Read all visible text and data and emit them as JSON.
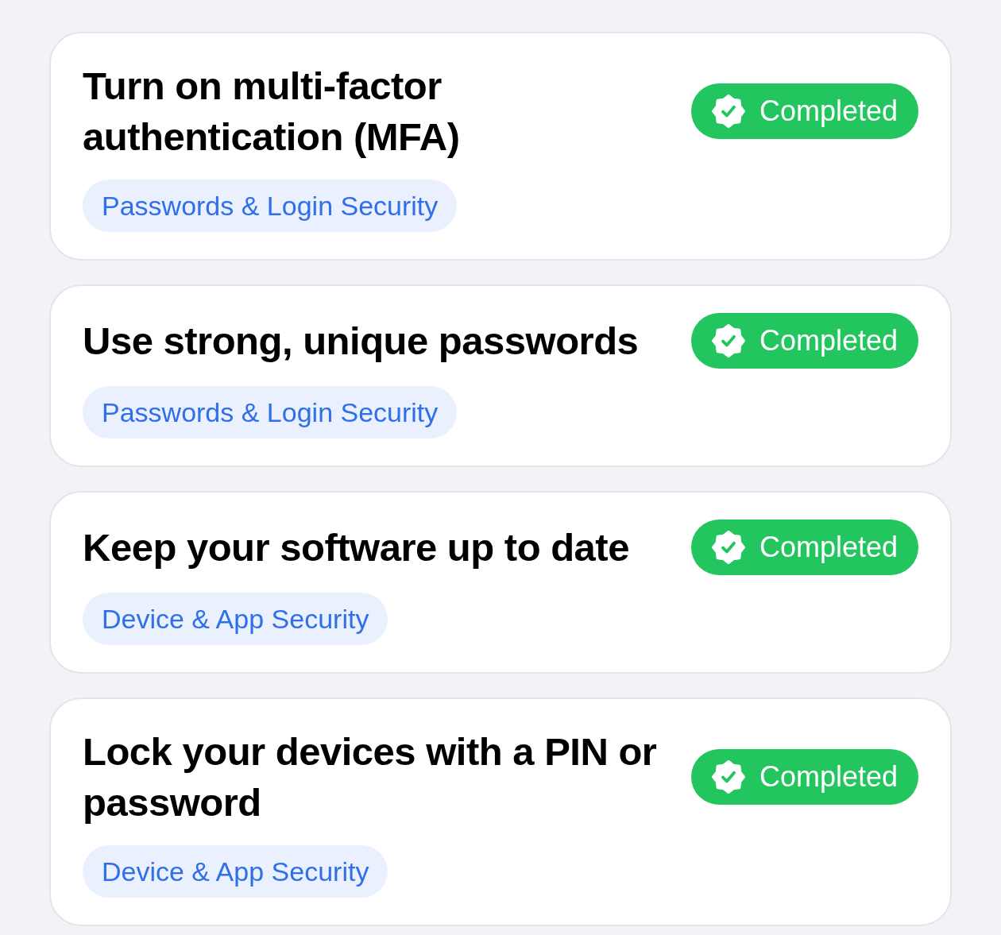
{
  "tasks": [
    {
      "title": "Turn on multi-factor authentication (MFA)",
      "category": "Passwords & Login Security",
      "status": {
        "kind": "completed",
        "label": "Completed"
      }
    },
    {
      "title": "Use strong, unique passwords",
      "category": "Passwords & Login Security",
      "status": {
        "kind": "completed",
        "label": "Completed"
      }
    },
    {
      "title": "Keep your software up to date",
      "category": "Device & App Security",
      "status": {
        "kind": "completed",
        "label": "Completed"
      }
    },
    {
      "title": "Lock your devices with a PIN or password",
      "category": "Device & App Security",
      "status": {
        "kind": "completed",
        "label": "Completed"
      }
    }
  ]
}
